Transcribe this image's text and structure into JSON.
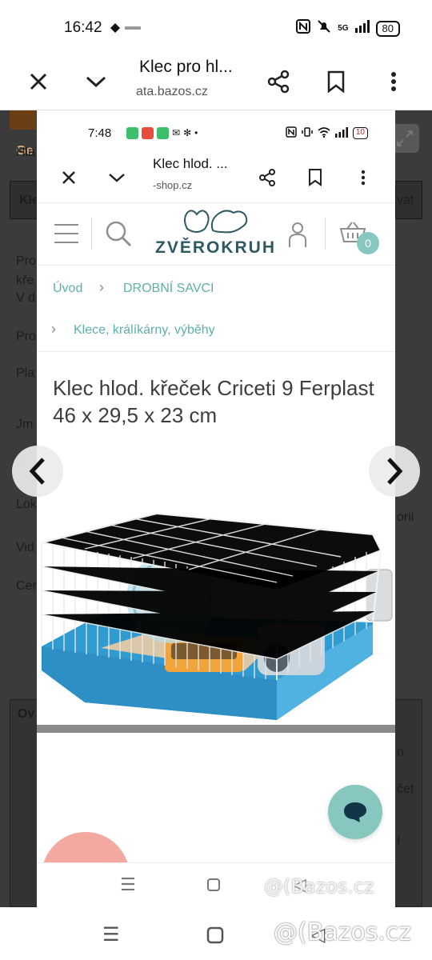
{
  "outer_status": {
    "time": "16:42",
    "net_label": "5G",
    "battery": "80"
  },
  "outer_browser": {
    "title": "Klec pro hl...",
    "url": "ata.bazos.cz"
  },
  "inner_status": {
    "time": "7:48",
    "battery": "10"
  },
  "inner_browser": {
    "title": "Klec hlod. ...",
    "url": "-shop.cz"
  },
  "shop": {
    "logo": "ZVĚROKRUH",
    "cart_count": "0"
  },
  "breadcrumbs": {
    "home": "Úvod",
    "category": "DROBNÍ SAVCI",
    "subcategory": "Klece, králíkárny, výběhy"
  },
  "product": {
    "title": "Klec hlod. křeček Criceti 9 Ferplast 46 x 29,5 x 23 cm"
  },
  "background_page": {
    "fragments": [
      "Ge",
      "Hla",
      "Kle",
      "vat",
      "Pro",
      "kře",
      "V d",
      "Pro",
      "Pla",
      "Jm",
      "Te",
      "Lok",
      "orii",
      "Vid",
      "Cer",
      "Ov",
      "n",
      "čet",
      "f"
    ]
  },
  "watermark": "@(Bazos.cz",
  "colors": {
    "accent_teal": "#88c7c0",
    "link_teal": "#5db0a8",
    "logo_dark": "#2e5963",
    "cage_blue": "#2f9bd0",
    "badge_pink": "#f3a8a0"
  }
}
